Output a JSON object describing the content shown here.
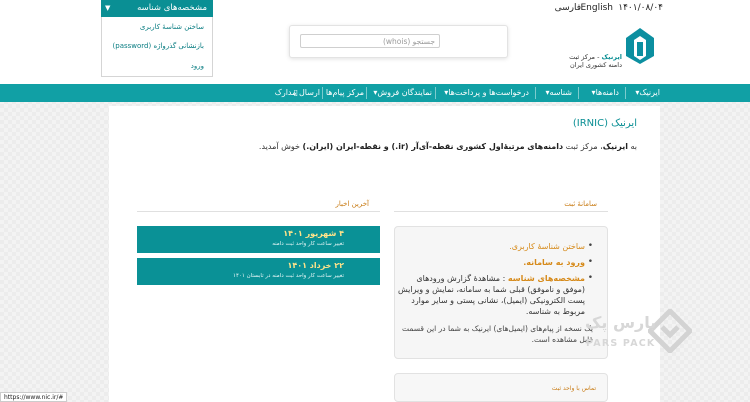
{
  "topbar": {
    "date": "۱۴۰۱/۰۸/۰۴",
    "lang_en": "English",
    "lang_fa": "فارسی",
    "identity_button": "مشخصه‌های شناسه"
  },
  "identity_menu": {
    "items": [
      "ساختن شناسهٔ کاربری",
      "بازنشانی گذرواژه (password)",
      "ورود"
    ]
  },
  "header": {
    "search_placeholder": "جستجو (whois)",
    "logo_name": "ایرنیک",
    "logo_line1": "- مرکز ثبت",
    "logo_line2": "دامنه کشوری ایران"
  },
  "nav": {
    "items": [
      "ایرنیک",
      "دامنه‌ها",
      "شناسه",
      "درخواست‌ها و پرداخت‌ها",
      "نمایندگان فروش",
      "مرکز پیام‌ها",
      "ارسال مدارک"
    ],
    "dropdown_mark": "▾"
  },
  "main": {
    "title": "ایرنیک (IRNIC)",
    "intro_prefix": "به ",
    "intro_bold1": "ایرنیک",
    "intro_mid": "، مرکز ثبت ",
    "intro_bold2": "دامنه‌های مرتبهٔ‌اول کشوری نقطه-آی‌آر (ir.) و نقطه-ایران (ایران.)",
    "intro_suffix": " خوش آمدید."
  },
  "news": {
    "heading": "آخرین اخبار",
    "items": [
      {
        "date": "۴ شهریور ۱۴۰۱",
        "desc": "تغییر ساعت کار واحد ثبت دامنه"
      },
      {
        "date": "۲۲ خرداد ۱۴۰۱",
        "desc": "تغییر ساعت کار واحد ثبت دامنه در تابستان ۱۴۰۱"
      }
    ]
  },
  "system": {
    "heading": "سامانهٔ ثبت",
    "create_id": "ساختن شناسهٔ کاربری.",
    "login": "ورود به سامانه.",
    "ids_label": "مشخصه‌های شناسه",
    "ids_desc": ": مشاهدهٔ گزارش ورودهای (موفق و ناموفق) قبلی شما به سامانه، نمایش و ویرایش پست الکترونیکی (ایمیل)، نشانی پستی و سایر موارد مربوط به شناسه.",
    "note": "یک نسخه از پیام‌های (ایمیل‌های) ایرنیک به شما در این قسمت قابل مشاهده است."
  },
  "contact": {
    "heading": "تماس با واحد ثبت"
  },
  "status_url": "https://www.nic.ir/#",
  "watermark": {
    "fa": "پارس پک",
    "en": "PARS PACK"
  }
}
